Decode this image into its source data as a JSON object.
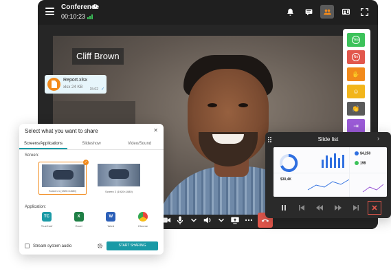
{
  "topbar": {
    "title": "Conference",
    "timer": "00:10:23",
    "icons": [
      "hamburger-icon",
      "info-icon",
      "signal-icon",
      "bell-icon",
      "chat-icon",
      "participants-icon",
      "screen-share-icon",
      "fullscreen-icon"
    ]
  },
  "video": {
    "participant_name": "Cliff Brown"
  },
  "reactions": [
    {
      "icon": "yes-icon",
      "label": "Yes",
      "color": "#3cc25a"
    },
    {
      "icon": "no-icon",
      "label": "No",
      "color": "#e2574c"
    },
    {
      "icon": "raise-hand-icon",
      "label": "",
      "color": "#f28a1b"
    },
    {
      "icon": "smile-icon",
      "label": "",
      "color": "#f2b51b"
    },
    {
      "icon": "clap-icon",
      "label": "",
      "color": "#5a5a5a"
    },
    {
      "icon": "leave-icon",
      "label": "",
      "color": "#9a5ad6"
    }
  ],
  "file_message": {
    "name": "Report.xlsx",
    "size": "xlsx 24 KB",
    "time": "15:02"
  },
  "share_dialog": {
    "title": "Select what you want to share",
    "tabs": [
      "Screens/Applications",
      "Slideshow",
      "Video/Sound"
    ],
    "active_tab": 0,
    "screen_label": "Screen:",
    "screens": [
      "Screen 1 (1920×1080)",
      "Screen 2 (1920×1080)"
    ],
    "selected_screen": 0,
    "application_label": "Application:",
    "apps": [
      {
        "label": "TrueConf",
        "color": "#1a9aa6",
        "glyph": "TC"
      },
      {
        "label": "Excel",
        "color": "#1e7f45",
        "glyph": "X"
      },
      {
        "label": "Word",
        "color": "#2b5fb8",
        "glyph": "W"
      },
      {
        "label": "Chrome",
        "color": "#e8453c",
        "glyph": "●"
      }
    ],
    "stream_audio_label": "Stream system audio",
    "start_button": "START SHARING"
  },
  "slide_list": {
    "title": "Slide list",
    "kpis": [
      "$4,250",
      "198",
      "$30,4K"
    ]
  },
  "colors": {
    "accent": "#1a9aa6",
    "end_call": "#e2574c",
    "file_icon": "#f28a1b"
  }
}
